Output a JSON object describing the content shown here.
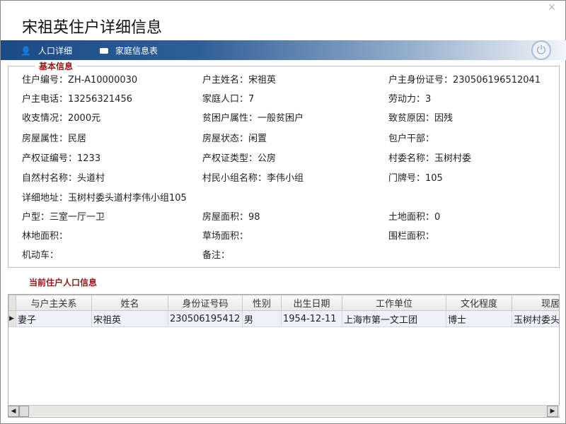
{
  "window": {
    "title": "宋祖英住户详细信息",
    "close_icon": "close-icon"
  },
  "nav": {
    "tabs": [
      {
        "label": "人口详细",
        "icon": "user-icon"
      },
      {
        "label": "家庭信息表",
        "icon": "card-icon"
      }
    ],
    "power_icon": "power-icon"
  },
  "basic": {
    "legend": "基本信息",
    "fields": [
      "住户编号：ZH-A10000030",
      "户主姓名：宋祖英",
      "户主身份证号：230506196512041",
      "户主电话：13256321456",
      "家庭人口：7",
      "劳动力：3",
      "收支情况：2000元",
      "贫困户属性：一般贫困户",
      "致贫原因：因残",
      "房屋属性：民居",
      "房屋状态：闲置",
      "包户干部：",
      "产权证编号：1233",
      "产权证类型：公房",
      "村委名称：玉树村委",
      "自然村名称：头道村",
      "村民小组名称：李伟小组",
      "门牌号：105",
      "详细地址：玉树村委头道村李伟小组105",
      "",
      "",
      "户型：三室一厅一卫",
      "房屋面积：98",
      "土地面积：0",
      "林地面积：",
      "草场面积：",
      "围栏面积：",
      "机动车：",
      "备注：",
      ""
    ]
  },
  "residents": {
    "title": "当前住户人口信息",
    "columns": [
      "与户主关系",
      "姓名",
      "身份证号码",
      "性别",
      "出生日期",
      "工作单位",
      "文化程度",
      "现居"
    ],
    "rows": [
      [
        "妻子",
        "宋祖英",
        "230506195412",
        "男",
        "1954-12-11",
        "上海市第一文工团",
        "博士",
        "玉树村委头"
      ]
    ]
  }
}
